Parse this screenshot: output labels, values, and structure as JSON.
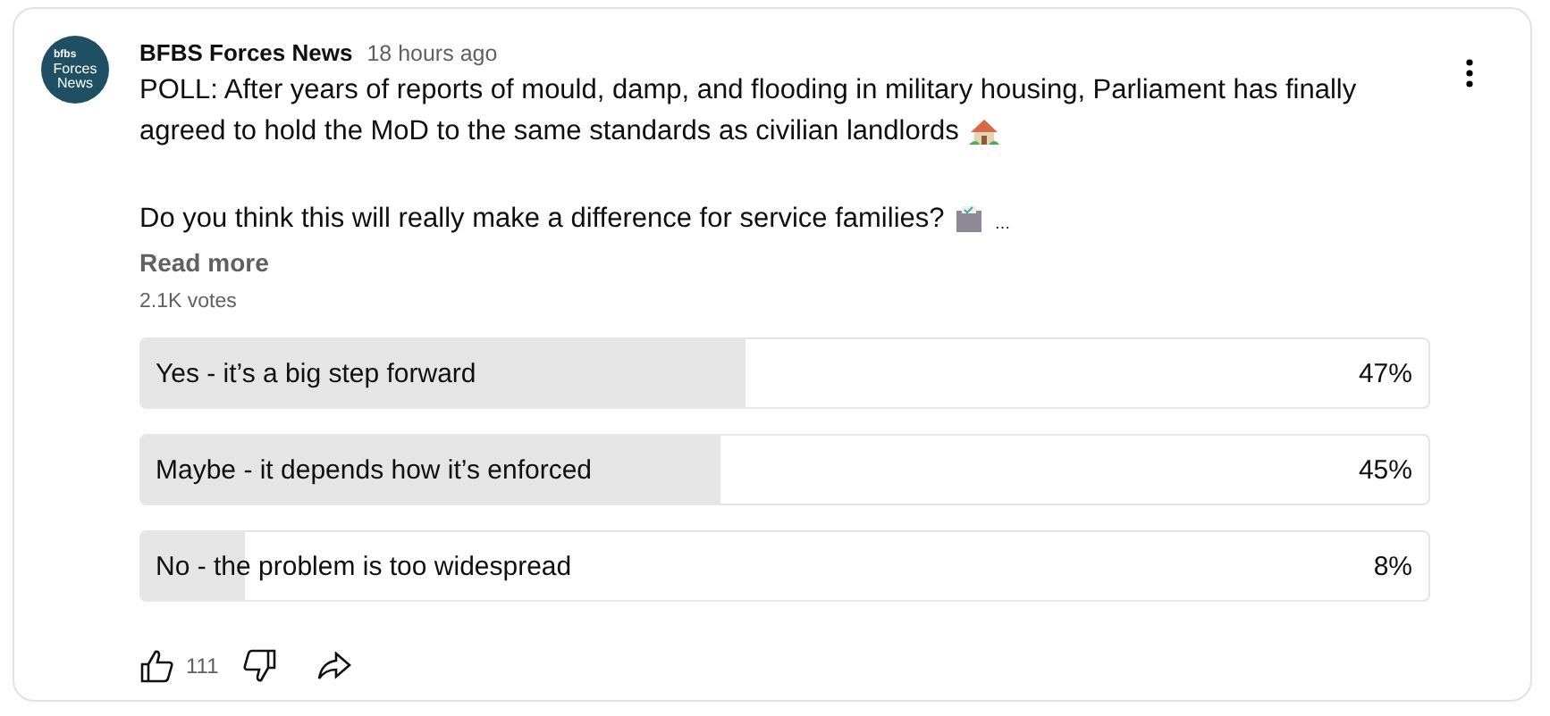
{
  "post": {
    "avatar": {
      "line_1": "bfbs",
      "line_2": "Forces",
      "line_3": "News"
    },
    "channel": "BFBS Forces News",
    "time": "18 hours ago",
    "paragraphs": [
      {
        "lines": [
          "POLL: After years of reports of mould, damp, and flooding in military housing, Parliament has finally",
          "agreed to hold the MoD to the same standards as civilian landlords"
        ]
      },
      {
        "lines": [
          "Do you think this will really make a difference for service families?"
        ],
        "ellipsis": "…"
      }
    ],
    "read_more": "Read more",
    "votes": "2.1K votes",
    "options": [
      {
        "label": "Yes - it’s a big step forward",
        "percent": "47%",
        "level": 0.47
      },
      {
        "label": "Maybe - it depends how it’s enforced",
        "percent": "45%",
        "level": 0.45
      },
      {
        "label": "No - the problem is too widespread",
        "percent": "8%",
        "level": 0.08
      }
    ],
    "likes": "111"
  }
}
